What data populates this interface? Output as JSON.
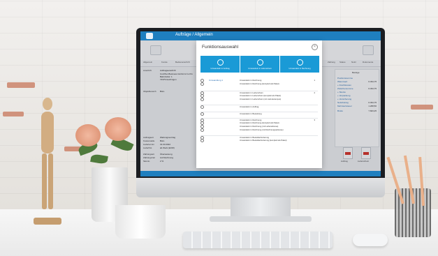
{
  "window": {
    "title": "Aufträge / Allgemein"
  },
  "modal": {
    "title": "Funktionsauswahl",
    "close_glyph": "×",
    "tiles": [
      {
        "label": "Umwandeln in Auftrag",
        "icon": "circle-icon"
      },
      {
        "label": "Umwandeln in Lieferschein",
        "icon": "circle-icon"
      },
      {
        "label": "Umwandeln in Rechnung",
        "icon": "circle-icon"
      }
    ],
    "options": [
      {
        "group": "Umwandlung 1",
        "text": "Umwandeln in Rechnung",
        "num": "1"
      },
      {
        "group": "",
        "text": "Umwandeln in Rechnung (komplett als Paket)",
        "num": ""
      },
      {
        "group": "",
        "text": "",
        "num": ""
      },
      {
        "group": "",
        "text": "Umwandeln in Lieferschein",
        "num": "2"
      },
      {
        "group": "",
        "text": "Umwandeln in Lieferschein (komplett als Paket)",
        "num": ""
      },
      {
        "group": "",
        "text": "Umwandeln in Lieferschein (mit Lieferantenpos)",
        "num": ""
      },
      {
        "group": "",
        "text": "Umwandeln in Auftrag",
        "num": ""
      },
      {
        "group": "",
        "text": "Umwandeln in Bestellung",
        "num": ""
      },
      {
        "group": "",
        "text": "Umwandeln in Rechnung",
        "num": "3"
      },
      {
        "group": "",
        "text": "Umwandeln in Rechnung (komplett als Paket)",
        "num": ""
      },
      {
        "group": "",
        "text": "Umwandeln in Rechnung (mit Lieferadresse)",
        "num": ""
      },
      {
        "group": "",
        "text": "Umwandeln in Rechnung (mit Rechnungsadresse)",
        "num": ""
      },
      {
        "group": "",
        "text": "Umwandeln in Bestellanforderung",
        "num": ""
      },
      {
        "group": "",
        "text": "Umwandeln in Bestellanforderung (komplett als Paket)",
        "num": ""
      }
    ]
  },
  "left_panel": {
    "rows": [
      {
        "label": "Anschrift",
        "value": "Auftragsanschrift"
      },
      {
        "label": "",
        "value": "Cul-Plan Business GmbH & Co KG"
      },
      {
        "label": "",
        "value": "Bahnhofstr. 1"
      },
      {
        "label": "",
        "value": "72379 Hechingen"
      },
      {
        "label": "Objektbereich",
        "value": "Büro"
      },
      {
        "label": "Auftragsart",
        "value": "Wartungsvertrag"
      },
      {
        "label": "Kostenstelle",
        "value": "Büro"
      },
      {
        "label": "Liefertermin",
        "value": "31.03.2022"
      },
      {
        "label": "Lieferfrist",
        "value": "ab Werk (EXW)"
      },
      {
        "label": "Zahlungsart",
        "value": "Überweisung"
      },
      {
        "label": "Zahlungsziel",
        "value": "Auf Rechnung"
      },
      {
        "label": "Skonto",
        "value": "2 %"
      }
    ]
  },
  "right_panel": {
    "header": "Beträge",
    "rows": [
      {
        "label": "Positionssumme",
        "value": ""
      },
      {
        "label": "Warenwert",
        "value": "6.334,75"
      },
      {
        "label": "+ Frachtkosten",
        "value": ""
      },
      {
        "label": "Zwischensumme",
        "value": "6.334,75"
      },
      {
        "label": "+ Skonto",
        "value": ""
      },
      {
        "label": "+ Verpackung",
        "value": ""
      },
      {
        "label": "+ Versicherung",
        "value": ""
      },
      {
        "label": "Nettobetrag",
        "value": "6.334,75"
      },
      {
        "label": "Mehrwertsteuer",
        "value": "1.268,50"
      },
      {
        "label": "Brutto",
        "value": "7.603,25"
      }
    ]
  },
  "documents": [
    {
      "label": "Auftrag"
    },
    {
      "label": "Lieferschein"
    }
  ],
  "tabs": [
    "Allgemein",
    "Kunde",
    "Bedienanschrift",
    "Zahlung",
    "Status",
    "Notiz",
    "Dokumente"
  ],
  "colors": {
    "accent": "#1a9ad6",
    "titlebar": "#1f7fbf"
  }
}
